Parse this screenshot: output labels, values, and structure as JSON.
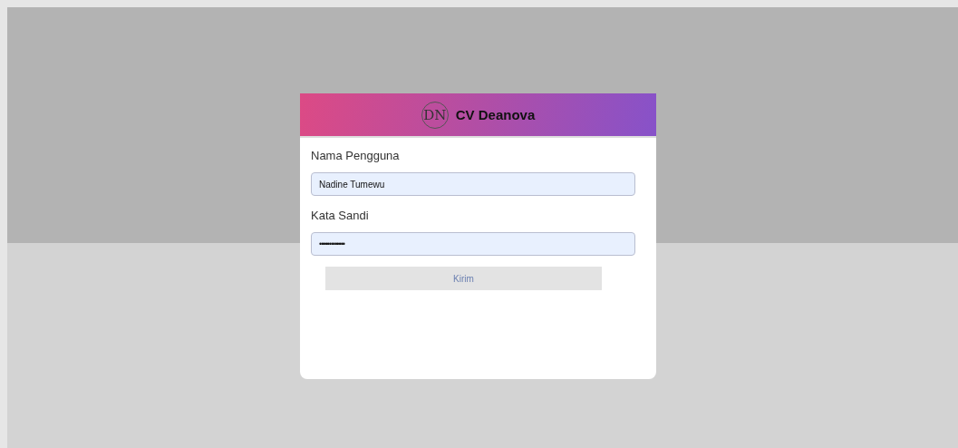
{
  "header": {
    "logo": "DN",
    "title": "CV Deanova"
  },
  "fields": [
    {
      "label": "Nama Pengguna",
      "value": "Nadine Tumewu",
      "kind": "text"
    },
    {
      "label": "Kata Sandi",
      "value": "•••••••••••••",
      "kind": "password"
    }
  ],
  "submit": {
    "label": "Kirim",
    "disabled": true
  }
}
